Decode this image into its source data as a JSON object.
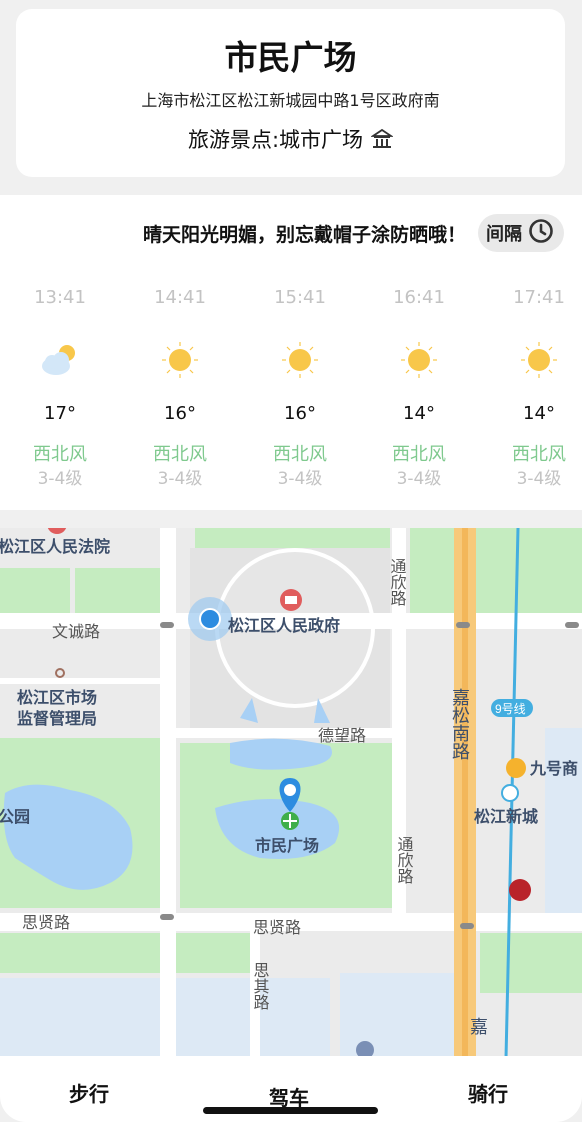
{
  "place": {
    "title": "市民广场",
    "address": "上海市松江区松江新城园中路1号区政府南",
    "type_label": "旅游景点:城市广场",
    "type_icon": "landmark-icon"
  },
  "weather": {
    "tip": "晴天阳光明媚，别忘戴帽子涂防晒哦！",
    "interval_label": "间隔",
    "interval_icon": "clock-icon",
    "forecast": [
      {
        "time": "13:41",
        "icon": "partly-cloudy-icon",
        "temp": "17°",
        "wind": "西北风",
        "level": "3-4级"
      },
      {
        "time": "14:41",
        "icon": "sunny-icon",
        "temp": "16°",
        "wind": "西北风",
        "level": "3-4级"
      },
      {
        "time": "15:41",
        "icon": "sunny-icon",
        "temp": "16°",
        "wind": "西北风",
        "level": "3-4级"
      },
      {
        "time": "16:41",
        "icon": "sunny-icon",
        "temp": "14°",
        "wind": "西北风",
        "level": "3-4级"
      },
      {
        "time": "17:41",
        "icon": "sunny-icon",
        "temp": "14°",
        "wind": "西北风",
        "level": "3-4级"
      }
    ]
  },
  "map": {
    "labels": {
      "court": "松江区人民法院",
      "wencheng_road": "文诚路",
      "government": "松江区人民政府",
      "market_bureau_1": "松江区市场",
      "market_bureau_2": "监督管理局",
      "dewang_road": "德望路",
      "park": "公园",
      "plaza": "市民广场",
      "sixian_road_left": "思贤路",
      "sixian_road_mid": "思贤路",
      "sixin_road_top": "通欣路",
      "sixin_road_mid": "通欣路",
      "siqi_road": "思其路",
      "jiasong_road": "嘉松南路",
      "jiasong_road_bottom": "嘉",
      "line9": "9号线",
      "jiuhao": "九号商",
      "songjiang_station": "松江新城"
    },
    "colors": {
      "park": "#c5ecc0",
      "water": "#a8d0f5",
      "road": "#ffffff",
      "highway": "#f7c97a",
      "metro": "#43aee0",
      "marker": "#2d8ce0"
    }
  },
  "tabs": {
    "walk": "步行",
    "drive": "驾车",
    "ride": "骑行"
  }
}
